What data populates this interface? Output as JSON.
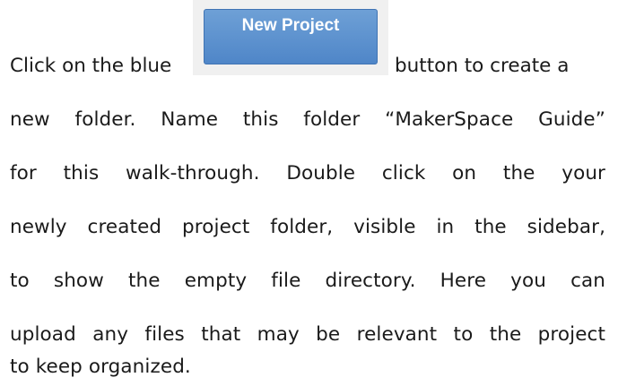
{
  "paragraph": {
    "line1_before": "Click on the blue",
    "button_label": "New Project",
    "line1_after": "button to create a",
    "line2": "new folder. Name this folder “MakerSpace Guide”",
    "line3": "for this walk-through. Double click on the your",
    "line4": "newly created project folder, visible in the sidebar,",
    "line5": "to show the empty file directory. Here you can",
    "line6": "upload any files that may be relevant to the project",
    "line7": "to keep organized."
  },
  "colors": {
    "button_bg": "#5b8fcf",
    "text": "#1a1a1a"
  }
}
